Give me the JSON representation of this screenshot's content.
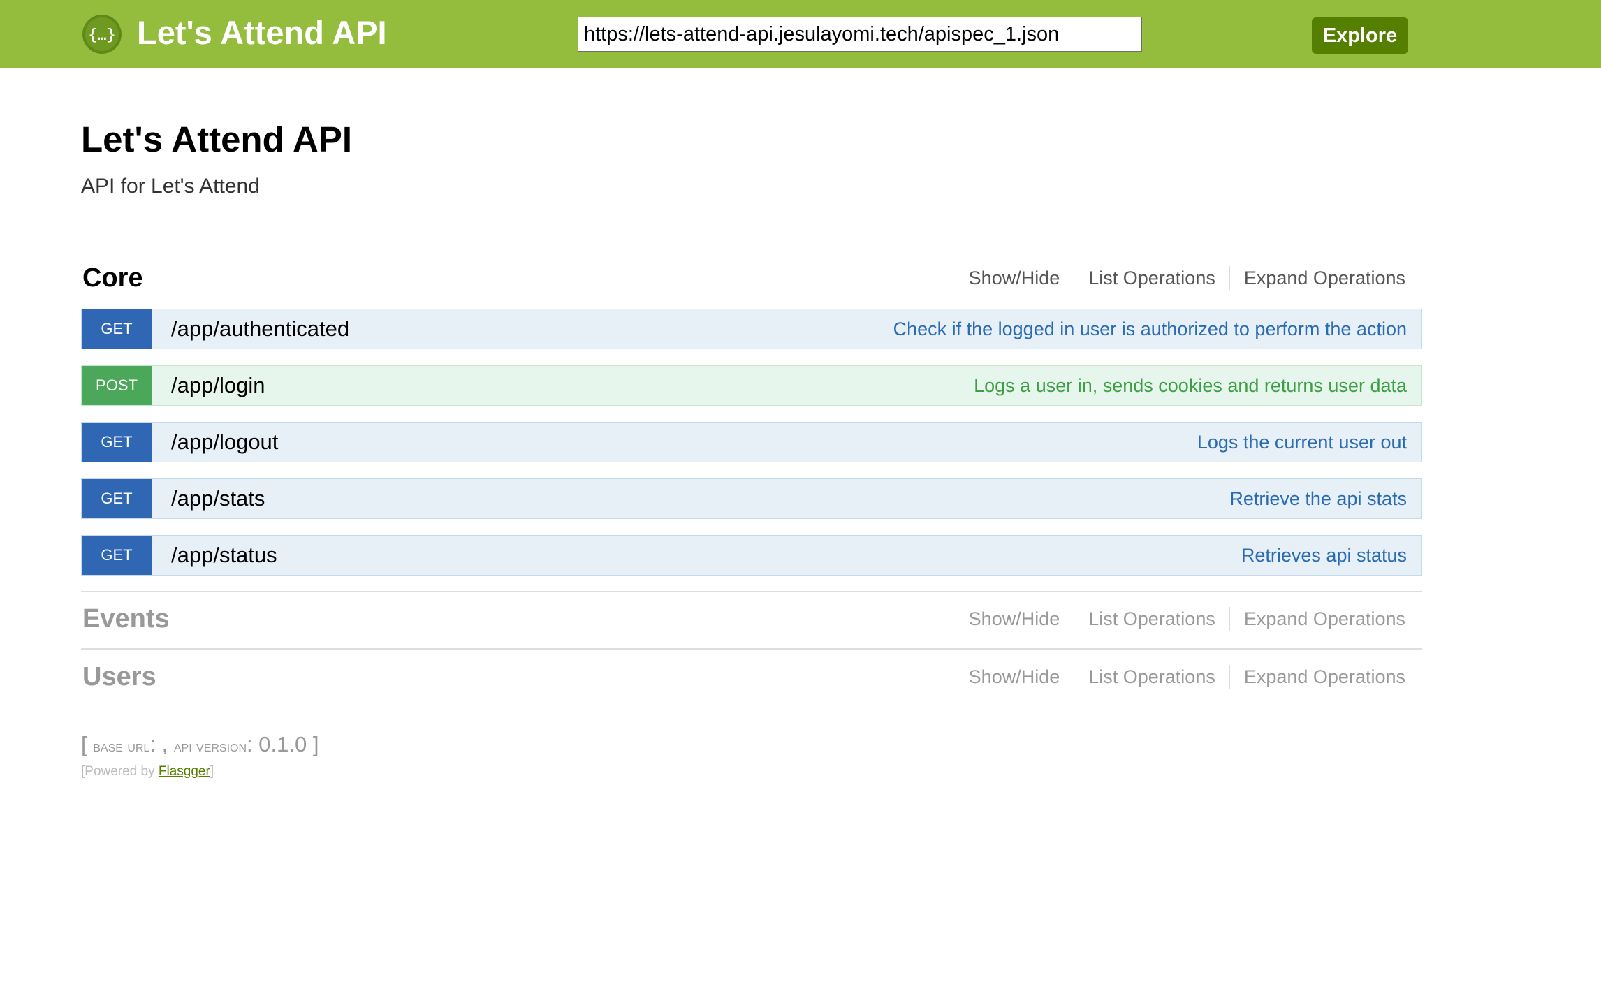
{
  "header": {
    "logo_icon": "swagger-braces-icon",
    "title": "Let's Attend API",
    "spec_url": "https://lets-attend-api.jesulayomi.tech/apispec_1.json",
    "explore_label": "Explore"
  },
  "info": {
    "title": "Let's Attend API",
    "description": "API for Let's Attend"
  },
  "actions": {
    "show_hide": "Show/Hide",
    "list_ops": "List Operations",
    "expand_ops": "Expand Operations"
  },
  "sections": [
    {
      "name": "Core",
      "operations": [
        {
          "method": "GET",
          "path": "/app/authenticated",
          "summary": "Check if the logged in user is authorized to perform the action"
        },
        {
          "method": "POST",
          "path": "/app/login",
          "summary": "Logs a user in, sends cookies and returns user data"
        },
        {
          "method": "GET",
          "path": "/app/logout",
          "summary": "Logs the current user out"
        },
        {
          "method": "GET",
          "path": "/app/stats",
          "summary": "Retrieve the api stats"
        },
        {
          "method": "GET",
          "path": "/app/status",
          "summary": "Retrieves api status"
        }
      ]
    },
    {
      "name": "Events",
      "operations": []
    },
    {
      "name": "Users",
      "operations": []
    }
  ],
  "footer": {
    "bracket_open": "[",
    "base_url_label": "base url",
    "base_url_value": ":",
    "sep": ",",
    "api_version_label": "api version",
    "api_version_value": ": 0.1.0",
    "bracket_close": "]",
    "powered_prefix": "[Powered by",
    "powered_link": "Flasgger",
    "powered_suffix": "]"
  },
  "colors": {
    "header_bg": "#94bd3e",
    "explore_bg": "#547f00",
    "get_verb": "#2f67b5",
    "post_verb": "#4ba75a",
    "get_row_bg": "#e7f0f7",
    "post_row_bg": "#e7f6ec"
  }
}
